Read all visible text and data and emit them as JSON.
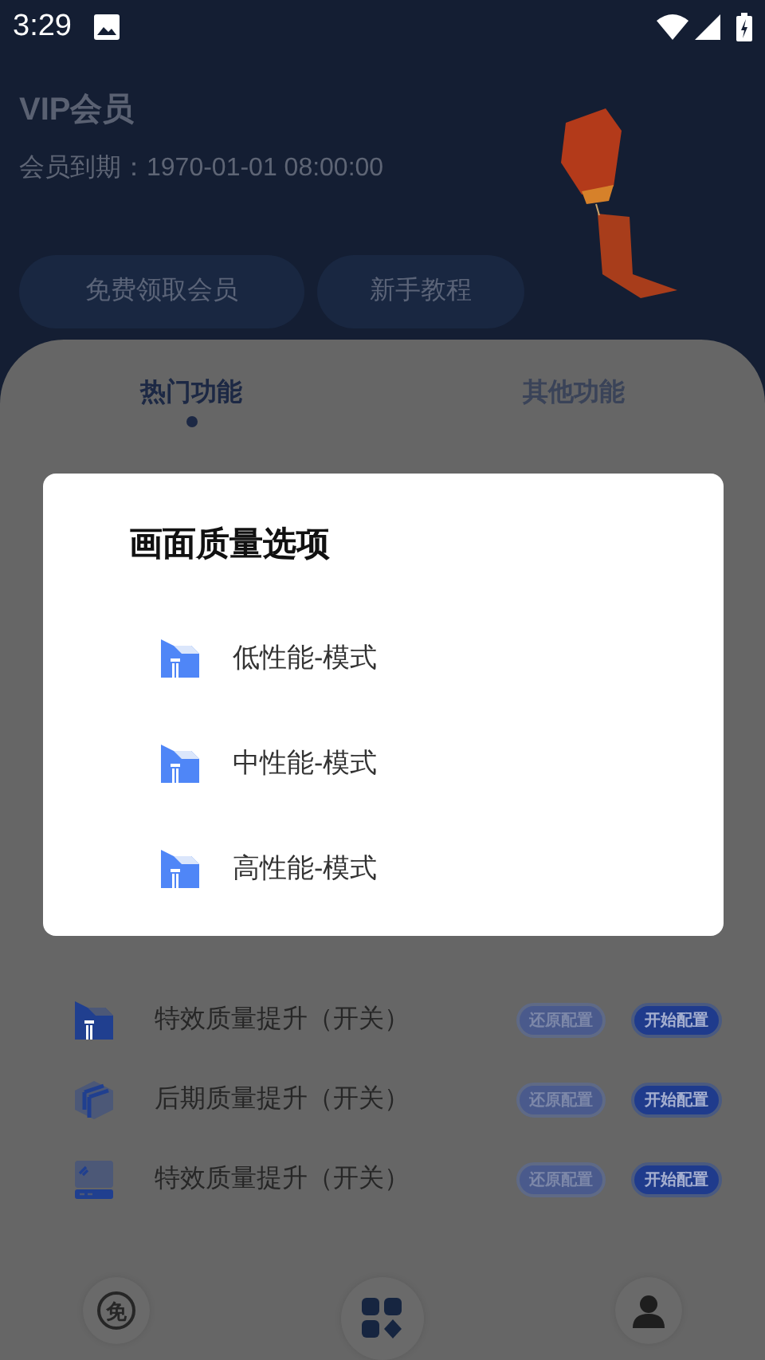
{
  "status_bar": {
    "time": "3:29"
  },
  "header": {
    "title": "VIP会员",
    "expiry": "会员到期：1970-01-01 08:00:00",
    "buttons": [
      "免费领取会员",
      "新手教程"
    ]
  },
  "tabs": [
    {
      "label": "热门功能",
      "selected": true
    },
    {
      "label": "其他功能",
      "selected": false
    }
  ],
  "features": [
    {
      "kind": "house",
      "name": "特效质量提升（开关）",
      "restore": "还原配置",
      "start": "开始配置"
    },
    {
      "kind": "cube",
      "name": "后期质量提升（开关）",
      "restore": "还原配置",
      "start": "开始配置"
    },
    {
      "kind": "card",
      "name": "特效质量提升（开关）",
      "restore": "还原配置",
      "start": "开始配置"
    }
  ],
  "dialog": {
    "title": "画面质量选项",
    "options": [
      "低性能-模式",
      "中性能-模式",
      "高性能-模式"
    ]
  },
  "bottom_nav": [
    {
      "kind": "free",
      "label": "免"
    },
    {
      "kind": "apps"
    },
    {
      "kind": "profile"
    }
  ]
}
